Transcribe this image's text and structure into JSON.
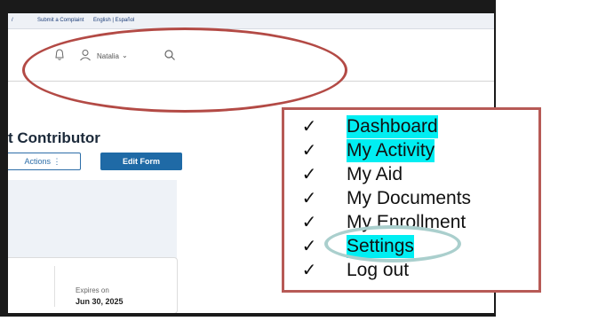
{
  "site": {
    "topbar": {
      "link_complaint": "Submit a Complaint",
      "lang": "English | Español"
    },
    "user_name": "Natalia",
    "page_title": "t Contributor",
    "actions_label": "Actions ⋮",
    "edit_form_label": "Edit Form",
    "expires_label": "Expires on",
    "expires_date": "Jun 30, 2025"
  },
  "menu": {
    "items": [
      {
        "label": "Dashboard",
        "highlighted": true
      },
      {
        "label": "My Activity",
        "highlighted": true
      },
      {
        "label": "My Aid",
        "highlighted": false
      },
      {
        "label": "My Documents",
        "highlighted": false
      },
      {
        "label": "My Enrollment",
        "highlighted": false
      },
      {
        "label": "Settings",
        "highlighted": true
      },
      {
        "label": "Log out",
        "highlighted": false
      }
    ],
    "check_glyph": "✓"
  },
  "colors": {
    "annotation_red": "#b34a45",
    "highlight_cyan": "#00eef2",
    "button_blue": "#1f6aa6"
  }
}
